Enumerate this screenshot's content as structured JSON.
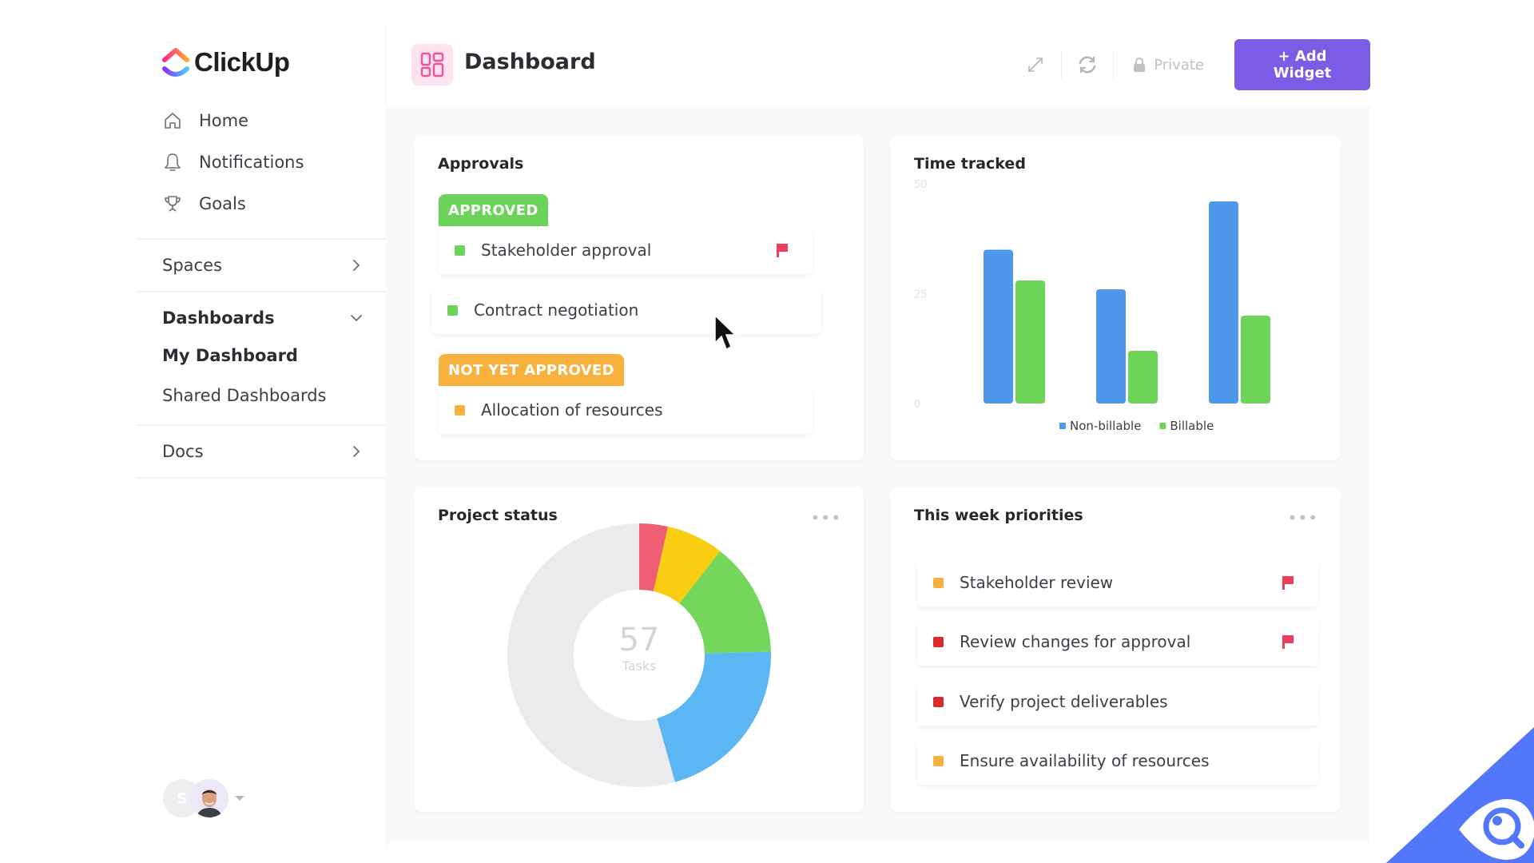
{
  "app": {
    "name": "ClickUp"
  },
  "sidebar": {
    "top_items": [
      {
        "label": "Home",
        "icon": "home-icon"
      },
      {
        "label": "Notifications",
        "icon": "bell-icon"
      },
      {
        "label": "Goals",
        "icon": "trophy-icon"
      }
    ],
    "spaces": {
      "label": "Spaces"
    },
    "dashboards": {
      "label": "Dashboards",
      "items": [
        {
          "label": "My Dashboard",
          "active": true
        },
        {
          "label": "Shared Dashboards",
          "active": false
        }
      ]
    },
    "docs": {
      "label": "Docs"
    },
    "user": {
      "initial": "S"
    }
  },
  "header": {
    "title": "Dashboard",
    "private_label": "Private",
    "add_widget_label": "+ Add Widget",
    "accent": "#7b5ce6"
  },
  "approvals": {
    "title": "Approvals",
    "groups": [
      {
        "status": "APPROVED",
        "color": "#6bd35a",
        "tasks": [
          {
            "name": "Stakeholder approval",
            "flag": true
          },
          {
            "name": "Contract negotiation",
            "flag": false
          }
        ]
      },
      {
        "status": "NOT YET APPROVED",
        "color": "#f6b23c",
        "tasks": [
          {
            "name": "Allocation of resources",
            "flag": false
          }
        ]
      }
    ]
  },
  "time_tracked": {
    "title": "Time tracked"
  },
  "project_status": {
    "title": "Project status",
    "total": "57",
    "total_label": "Tasks",
    "more_label": "•••"
  },
  "priorities": {
    "title": "This week priorities",
    "more_label": "•••",
    "tasks": [
      {
        "name": "Stakeholder review",
        "color": "#f6b23c",
        "flag": true
      },
      {
        "name": "Review changes for approval",
        "color": "#d92b2b",
        "flag": true
      },
      {
        "name": "Verify project deliverables",
        "color": "#d92b2b",
        "flag": false
      },
      {
        "name": "Ensure availability of resources",
        "color": "#f6b23c",
        "flag": false
      }
    ]
  },
  "chart_data": [
    {
      "type": "bar",
      "title": "Time tracked",
      "categories": [
        "",
        "",
        ""
      ],
      "series": [
        {
          "name": "Non-billable",
          "color": "#4e97ea",
          "values": [
            35,
            26,
            46
          ]
        },
        {
          "name": "Billable",
          "color": "#6fd45a",
          "values": [
            28,
            12,
            20
          ]
        }
      ],
      "yticks": [
        0,
        25,
        50
      ],
      "ylim": [
        0,
        50
      ],
      "xlabel": "",
      "ylabel": "",
      "grid": false,
      "legend": "bottom-center"
    },
    {
      "type": "pie",
      "title": "Project status",
      "donut": true,
      "center_value": "57",
      "center_label": "Tasks",
      "slices": [
        {
          "label": "Red",
          "value": 2,
          "color": "#ef5f73"
        },
        {
          "label": "Yellow",
          "value": 4,
          "color": "#f8cd12"
        },
        {
          "label": "Green",
          "value": 8,
          "color": "#74d65a"
        },
        {
          "label": "Blue",
          "value": 12,
          "color": "#5cb6f4"
        },
        {
          "label": "Gray",
          "value": 31,
          "color": "#ebebee"
        }
      ]
    }
  ]
}
